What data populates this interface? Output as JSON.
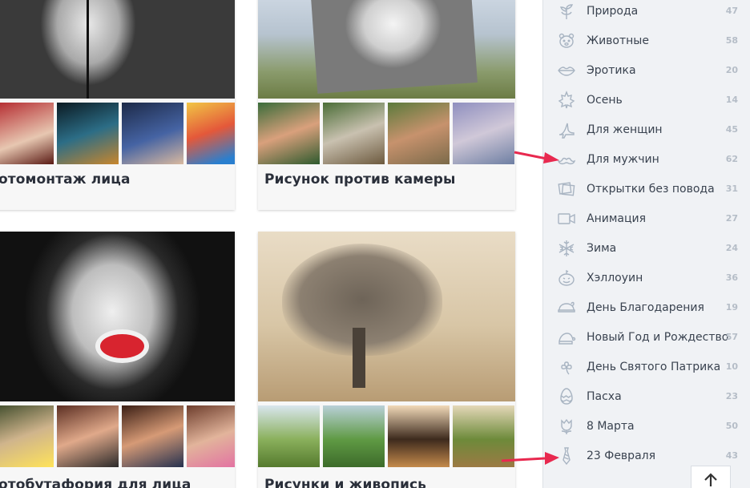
{
  "cards": [
    {
      "title": "отомонтаж лица"
    },
    {
      "title": "Рисунок против камеры"
    },
    {
      "title": "отобутафория для лица"
    },
    {
      "title": "Рисунки и живопись"
    }
  ],
  "sidebar": {
    "items": [
      {
        "label": "Природа",
        "count": "47",
        "icon": "sprout-icon"
      },
      {
        "label": "Животные",
        "count": "58",
        "icon": "bear-face-icon"
      },
      {
        "label": "Эротика",
        "count": "20",
        "icon": "lips-icon"
      },
      {
        "label": "Осень",
        "count": "14",
        "icon": "maple-leaf-icon"
      },
      {
        "label": "Для женщин",
        "count": "45",
        "icon": "high-heel-icon"
      },
      {
        "label": "Для мужчин",
        "count": "62",
        "icon": "mustache-icon"
      },
      {
        "label": "Открытки без повода",
        "count": "31",
        "icon": "postcards-icon"
      },
      {
        "label": "Анимация",
        "count": "27",
        "icon": "video-camera-icon"
      },
      {
        "label": "Зима",
        "count": "24",
        "icon": "snowflake-icon"
      },
      {
        "label": "Хэллоуин",
        "count": "36",
        "icon": "pumpkin-icon"
      },
      {
        "label": "День Благодарения",
        "count": "19",
        "icon": "turkey-icon"
      },
      {
        "label": "Новый Год и Рождество",
        "count": "57",
        "icon": "santa-hat-icon"
      },
      {
        "label": "День Святого Патрика",
        "count": "10",
        "icon": "shamrock-icon"
      },
      {
        "label": "Пасха",
        "count": "23",
        "icon": "easter-egg-icon"
      },
      {
        "label": "8 Марта",
        "count": "50",
        "icon": "tulip-icon"
      },
      {
        "label": "23 Февраля",
        "count": "43",
        "icon": "necktie-icon"
      }
    ]
  },
  "colors": {
    "annotation_arrow": "#e8294f",
    "sidebar_bg": "#f0f2f5",
    "icon_stroke": "#a8b4c2"
  }
}
